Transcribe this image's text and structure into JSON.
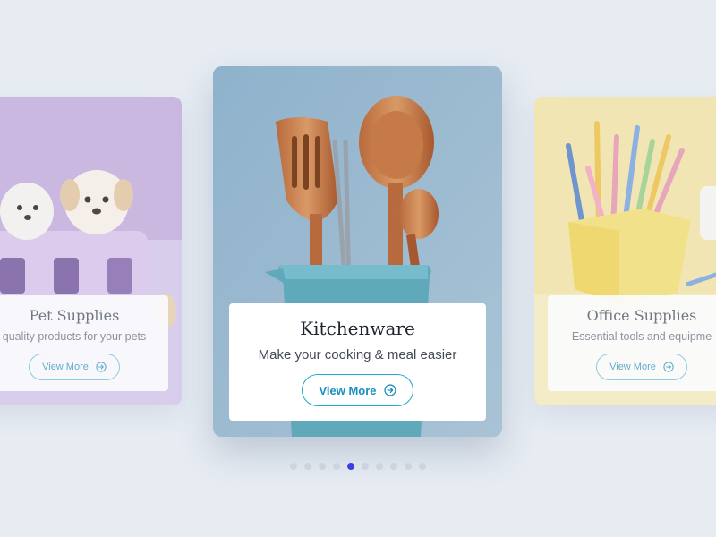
{
  "colors": {
    "background": "#e7ecf3",
    "accent": "#22a7cf",
    "active_dot": "#3b3fe0",
    "inactive_dot": "#cdd4de"
  },
  "carousel": {
    "active_index": 4,
    "dot_count": 10,
    "cards": {
      "pets": {
        "title": "Pet Supplies",
        "subtitle": "quality products for your pets",
        "button": "View More",
        "icon": "arrow-right-circle-icon"
      },
      "kitchen": {
        "title": "Kitchenware",
        "subtitle": "Make your cooking & meal easier",
        "button": "View More",
        "icon": "arrow-right-circle-icon"
      },
      "office": {
        "title": "Office Supplies",
        "subtitle": "Essential tools and equipme",
        "button": "View More",
        "icon": "arrow-right-circle-icon"
      }
    }
  }
}
